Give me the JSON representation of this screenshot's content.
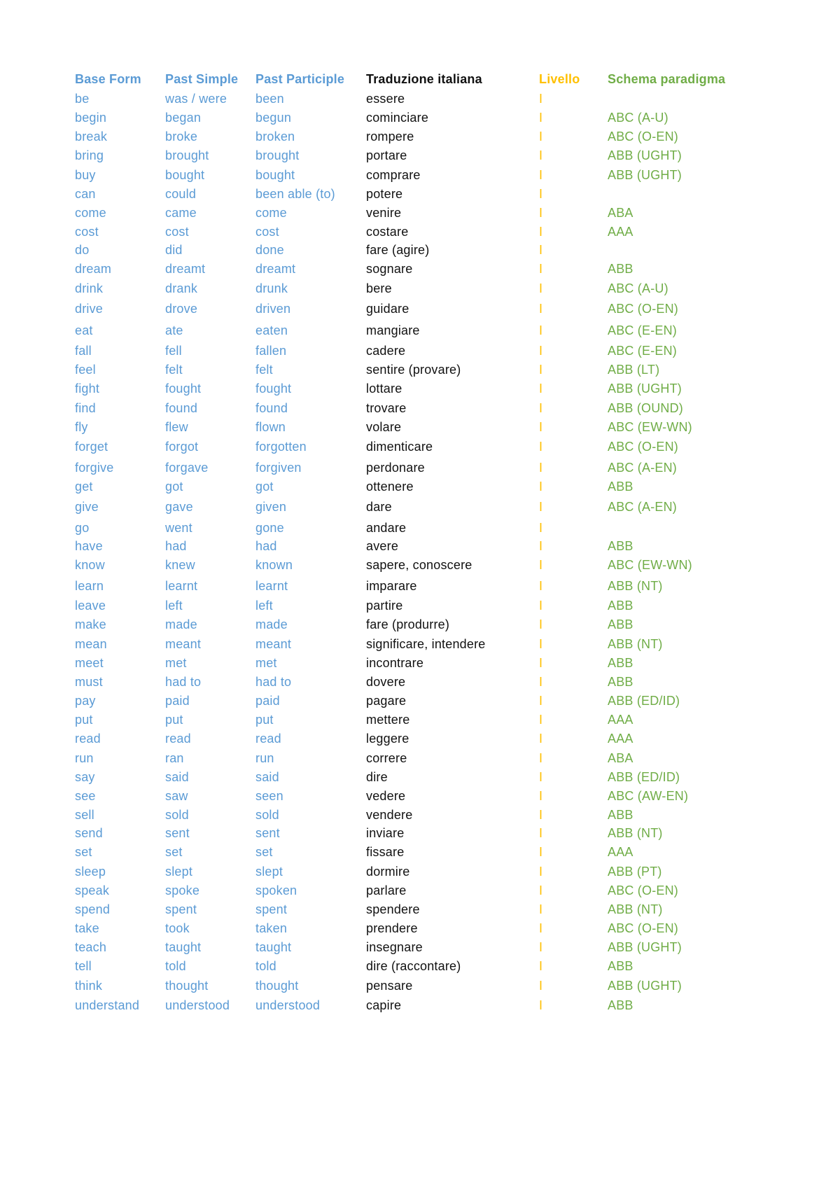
{
  "colors": {
    "english": "#5b9bd5",
    "italian": "#111111",
    "level": "#ffc000",
    "schema": "#70ad47"
  },
  "header": {
    "base_form": "Base Form",
    "past_simple": "Past Simple",
    "past_participle": "Past Participle",
    "translation": "Traduzione italiana",
    "level": "Livello",
    "schema": "Schema paradigma"
  },
  "rows": [
    {
      "base": "be",
      "past": "was / were",
      "participle": "been",
      "italian": "essere",
      "level": "I",
      "schema": ""
    },
    {
      "base": "begin",
      "past": "began",
      "participle": "begun",
      "italian": "cominciare",
      "level": "I",
      "schema": "ABC (A-U)"
    },
    {
      "base": "break",
      "past": "broke",
      "participle": "broken",
      "italian": "rompere",
      "level": "I",
      "schema": "ABC (O-EN)"
    },
    {
      "base": "bring",
      "past": "brought",
      "participle": "brought",
      "italian": "portare",
      "level": "I",
      "schema": "ABB (UGHT)"
    },
    {
      "base": "buy",
      "past": "bought",
      "participle": "bought",
      "italian": "comprare",
      "level": "I",
      "schema": "ABB (UGHT)"
    },
    {
      "base": "can",
      "past": "could",
      "participle": "been able (to)",
      "italian": "potere",
      "level": "I",
      "schema": ""
    },
    {
      "base": "come",
      "past": "came",
      "participle": "come",
      "italian": "venire",
      "level": "I",
      "schema": "ABA"
    },
    {
      "base": "cost",
      "past": "cost",
      "participle": "cost",
      "italian": "costare",
      "level": "I",
      "schema": "AAA"
    },
    {
      "base": "do",
      "past": "did",
      "participle": "done",
      "italian": "fare (agire)",
      "level": "I",
      "schema": ""
    },
    {
      "base": "dream",
      "past": "dreamt",
      "participle": "dreamt",
      "italian": "sognare",
      "level": "I",
      "schema": "ABB"
    },
    {
      "base": "drink",
      "past": "drank",
      "participle": "drunk",
      "italian": "bere",
      "level": "I",
      "schema": "ABC (A-U)"
    },
    {
      "base": "drive",
      "past": "drove",
      "participle": "driven",
      "italian": "guidare",
      "level": "I",
      "schema": "ABC (O-EN)"
    },
    {
      "base": "eat",
      "past": "ate",
      "participle": "eaten",
      "italian": "mangiare",
      "level": "I",
      "schema": "ABC (E-EN)"
    },
    {
      "base": "fall",
      "past": "fell",
      "participle": "fallen",
      "italian": "cadere",
      "level": "I",
      "schema": "ABC (E-EN)"
    },
    {
      "base": "feel",
      "past": "felt",
      "participle": "felt",
      "italian": "sentire (provare)",
      "level": "I",
      "schema": "ABB (LT)"
    },
    {
      "base": "fight",
      "past": "fought",
      "participle": "fought",
      "italian": "lottare",
      "level": "I",
      "schema": "ABB (UGHT)"
    },
    {
      "base": "find",
      "past": "found",
      "participle": "found",
      "italian": "trovare",
      "level": "I",
      "schema": "ABB (OUND)"
    },
    {
      "base": "fly",
      "past": "flew",
      "participle": "flown",
      "italian": "volare",
      "level": "I",
      "schema": "ABC (EW-WN)"
    },
    {
      "base": "forget",
      "past": "forgot",
      "participle": "forgotten",
      "italian": "dimenticare",
      "level": "I",
      "schema": "ABC (O-EN)"
    },
    {
      "base": "forgive",
      "past": "forgave",
      "participle": "forgiven",
      "italian": "perdonare",
      "level": "I",
      "schema": "ABC (A-EN)"
    },
    {
      "base": "get",
      "past": "got",
      "participle": "got",
      "italian": "ottenere",
      "level": "I",
      "schema": "ABB"
    },
    {
      "base": "give",
      "past": "gave",
      "participle": "given",
      "italian": "dare",
      "level": "I",
      "schema": "ABC (A-EN)"
    },
    {
      "base": "go",
      "past": "went",
      "participle": "gone",
      "italian": "andare",
      "level": "I",
      "schema": ""
    },
    {
      "base": "have",
      "past": "had",
      "participle": "had",
      "italian": "avere",
      "level": "I",
      "schema": "ABB"
    },
    {
      "base": "know",
      "past": "knew",
      "participle": "known",
      "italian": "sapere, conoscere",
      "level": "I",
      "schema": "ABC (EW-WN)"
    },
    {
      "base": "learn",
      "past": "learnt",
      "participle": "learnt",
      "italian": "imparare",
      "level": "I",
      "schema": "ABB (NT)"
    },
    {
      "base": "leave",
      "past": "left",
      "participle": "left",
      "italian": "partire",
      "level": "I",
      "schema": "ABB"
    },
    {
      "base": "make",
      "past": "made",
      "participle": "made",
      "italian": "fare (produrre)",
      "level": "I",
      "schema": "ABB"
    },
    {
      "base": "mean",
      "past": "meant",
      "participle": "meant",
      "italian": "significare, intendere",
      "level": "I",
      "schema": "ABB (NT)"
    },
    {
      "base": "meet",
      "past": "met",
      "participle": "met",
      "italian": "incontrare",
      "level": "I",
      "schema": "ABB"
    },
    {
      "base": "must",
      "past": "had to",
      "participle": "had to",
      "italian": "dovere",
      "level": "I",
      "schema": "ABB"
    },
    {
      "base": "pay",
      "past": "paid",
      "participle": "paid",
      "italian": "pagare",
      "level": "I",
      "schema": "ABB (ED/ID)"
    },
    {
      "base": "put",
      "past": "put",
      "participle": "put",
      "italian": "mettere",
      "level": "I",
      "schema": "AAA"
    },
    {
      "base": "read",
      "past": "read",
      "participle": "read",
      "italian": "leggere",
      "level": "I",
      "schema": "AAA"
    },
    {
      "base": "run",
      "past": "ran",
      "participle": "run",
      "italian": "correre",
      "level": "I",
      "schema": "ABA"
    },
    {
      "base": "say",
      "past": "said",
      "participle": "said",
      "italian": "dire",
      "level": "I",
      "schema": "ABB (ED/ID)"
    },
    {
      "base": "see",
      "past": "saw",
      "participle": "seen",
      "italian": "vedere",
      "level": "I",
      "schema": "ABC (AW-EN)"
    },
    {
      "base": "sell",
      "past": "sold",
      "participle": "sold",
      "italian": "vendere",
      "level": "I",
      "schema": "ABB"
    },
    {
      "base": "send",
      "past": "sent",
      "participle": "sent",
      "italian": "inviare",
      "level": "I",
      "schema": "ABB (NT)"
    },
    {
      "base": "set",
      "past": "set",
      "participle": "set",
      "italian": "fissare",
      "level": "I",
      "schema": "AAA"
    },
    {
      "base": "sleep",
      "past": "slept",
      "participle": "slept",
      "italian": "dormire",
      "level": "I",
      "schema": "ABB (PT)"
    },
    {
      "base": "speak",
      "past": "spoke",
      "participle": "spoken",
      "italian": "parlare",
      "level": "I",
      "schema": "ABC (O-EN)"
    },
    {
      "base": "spend",
      "past": "spent",
      "participle": "spent",
      "italian": "spendere",
      "level": "I",
      "schema": "ABB (NT)"
    },
    {
      "base": "take",
      "past": "took",
      "participle": "taken",
      "italian": "prendere",
      "level": "I",
      "schema": "ABC (O-EN)"
    },
    {
      "base": "teach",
      "past": "taught",
      "participle": "taught",
      "italian": "insegnare",
      "level": "I",
      "schema": "ABB (UGHT)"
    },
    {
      "base": "tell",
      "past": "told",
      "participle": "told",
      "italian": "dire (raccontare)",
      "level": "I",
      "schema": "ABB"
    },
    {
      "base": "think",
      "past": "thought",
      "participle": "thought",
      "italian": "pensare",
      "level": "I",
      "schema": "ABB (UGHT)"
    },
    {
      "base": "understand",
      "past": "understood",
      "participle": "understood",
      "italian": "capire",
      "level": "I",
      "schema": "ABB"
    }
  ]
}
